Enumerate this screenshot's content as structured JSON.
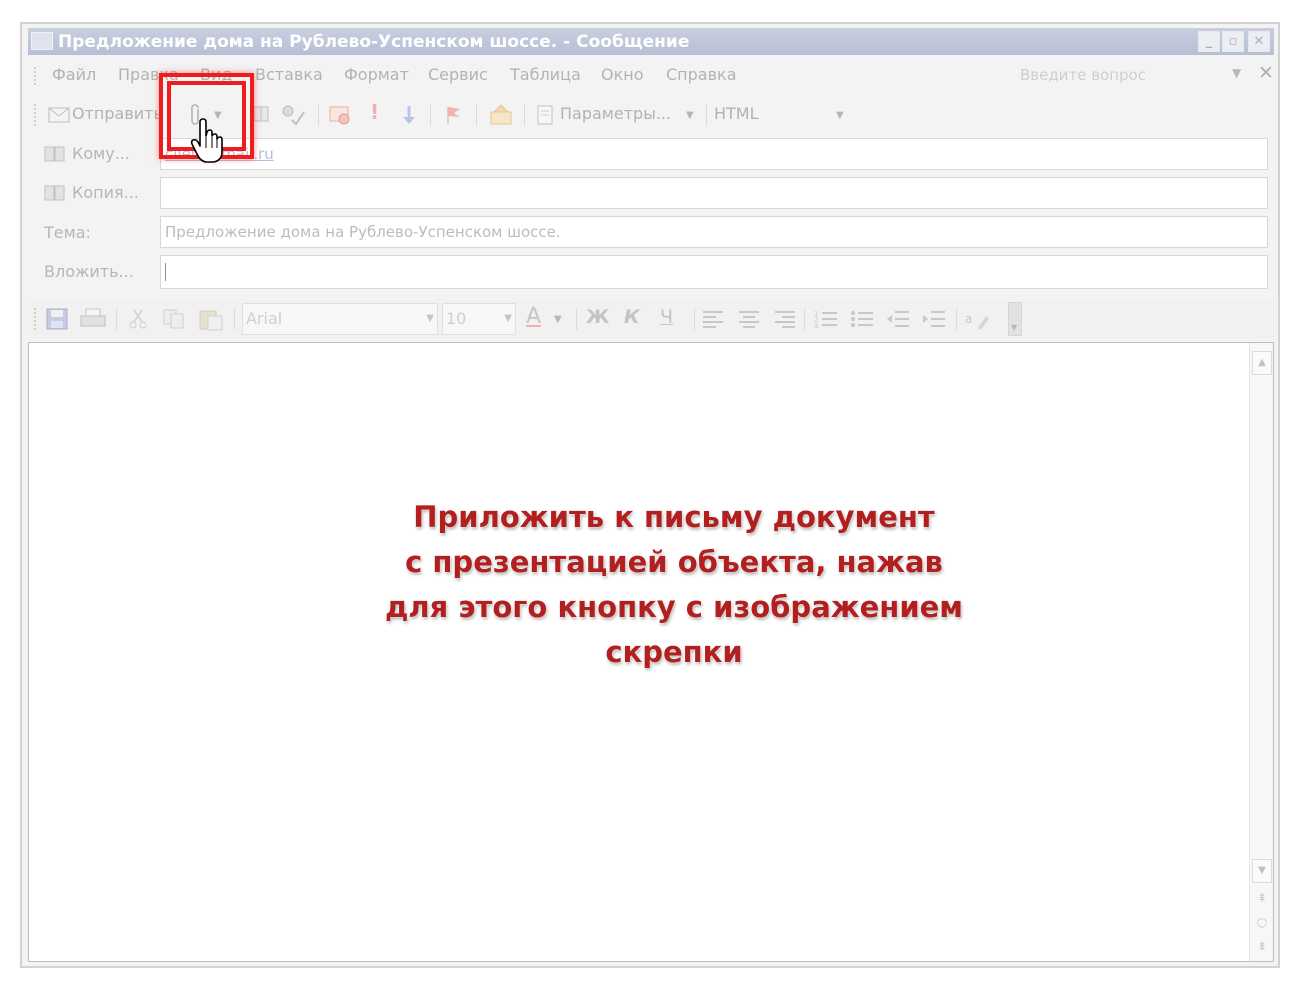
{
  "window": {
    "title": "Предложение дома на Рублево-Успенском шоссе. - Сообщение",
    "controls": {
      "minimize": "_",
      "restore": "▫",
      "close": "✕"
    }
  },
  "menu": {
    "items": [
      "Файл",
      "Правка",
      "Вид",
      "Вставка",
      "Формат",
      "Сервис",
      "Таблица",
      "Окно",
      "Справка"
    ],
    "question_placeholder": "Введите вопрос",
    "close": "✕"
  },
  "toolbar": {
    "send_label": "Отправить",
    "params_label": "Параметры...",
    "format_value": "HTML"
  },
  "fields": {
    "to_label": "Кому...",
    "to_value": "client@mail.ru",
    "cc_label": "Копия...",
    "cc_value": "",
    "subject_label": "Тема:",
    "subject_value": "Предложение дома на Рублево-Успенском шоссе.",
    "attach_label": "Вложить...",
    "attach_value": ""
  },
  "format_toolbar": {
    "font_value": "Arial",
    "size_value": "10",
    "bold": "Ж",
    "italic": "К",
    "underline": "Ч",
    "font_color": "A"
  },
  "caption": {
    "text": "Приложить к письму документ\nс презентацией объекта, нажав\nдля этого кнопку с изображением\nскрепки"
  },
  "colors": {
    "highlight": "#ee1c1c",
    "caption": "#b21f1f",
    "titlebar": "#c0c7da"
  }
}
